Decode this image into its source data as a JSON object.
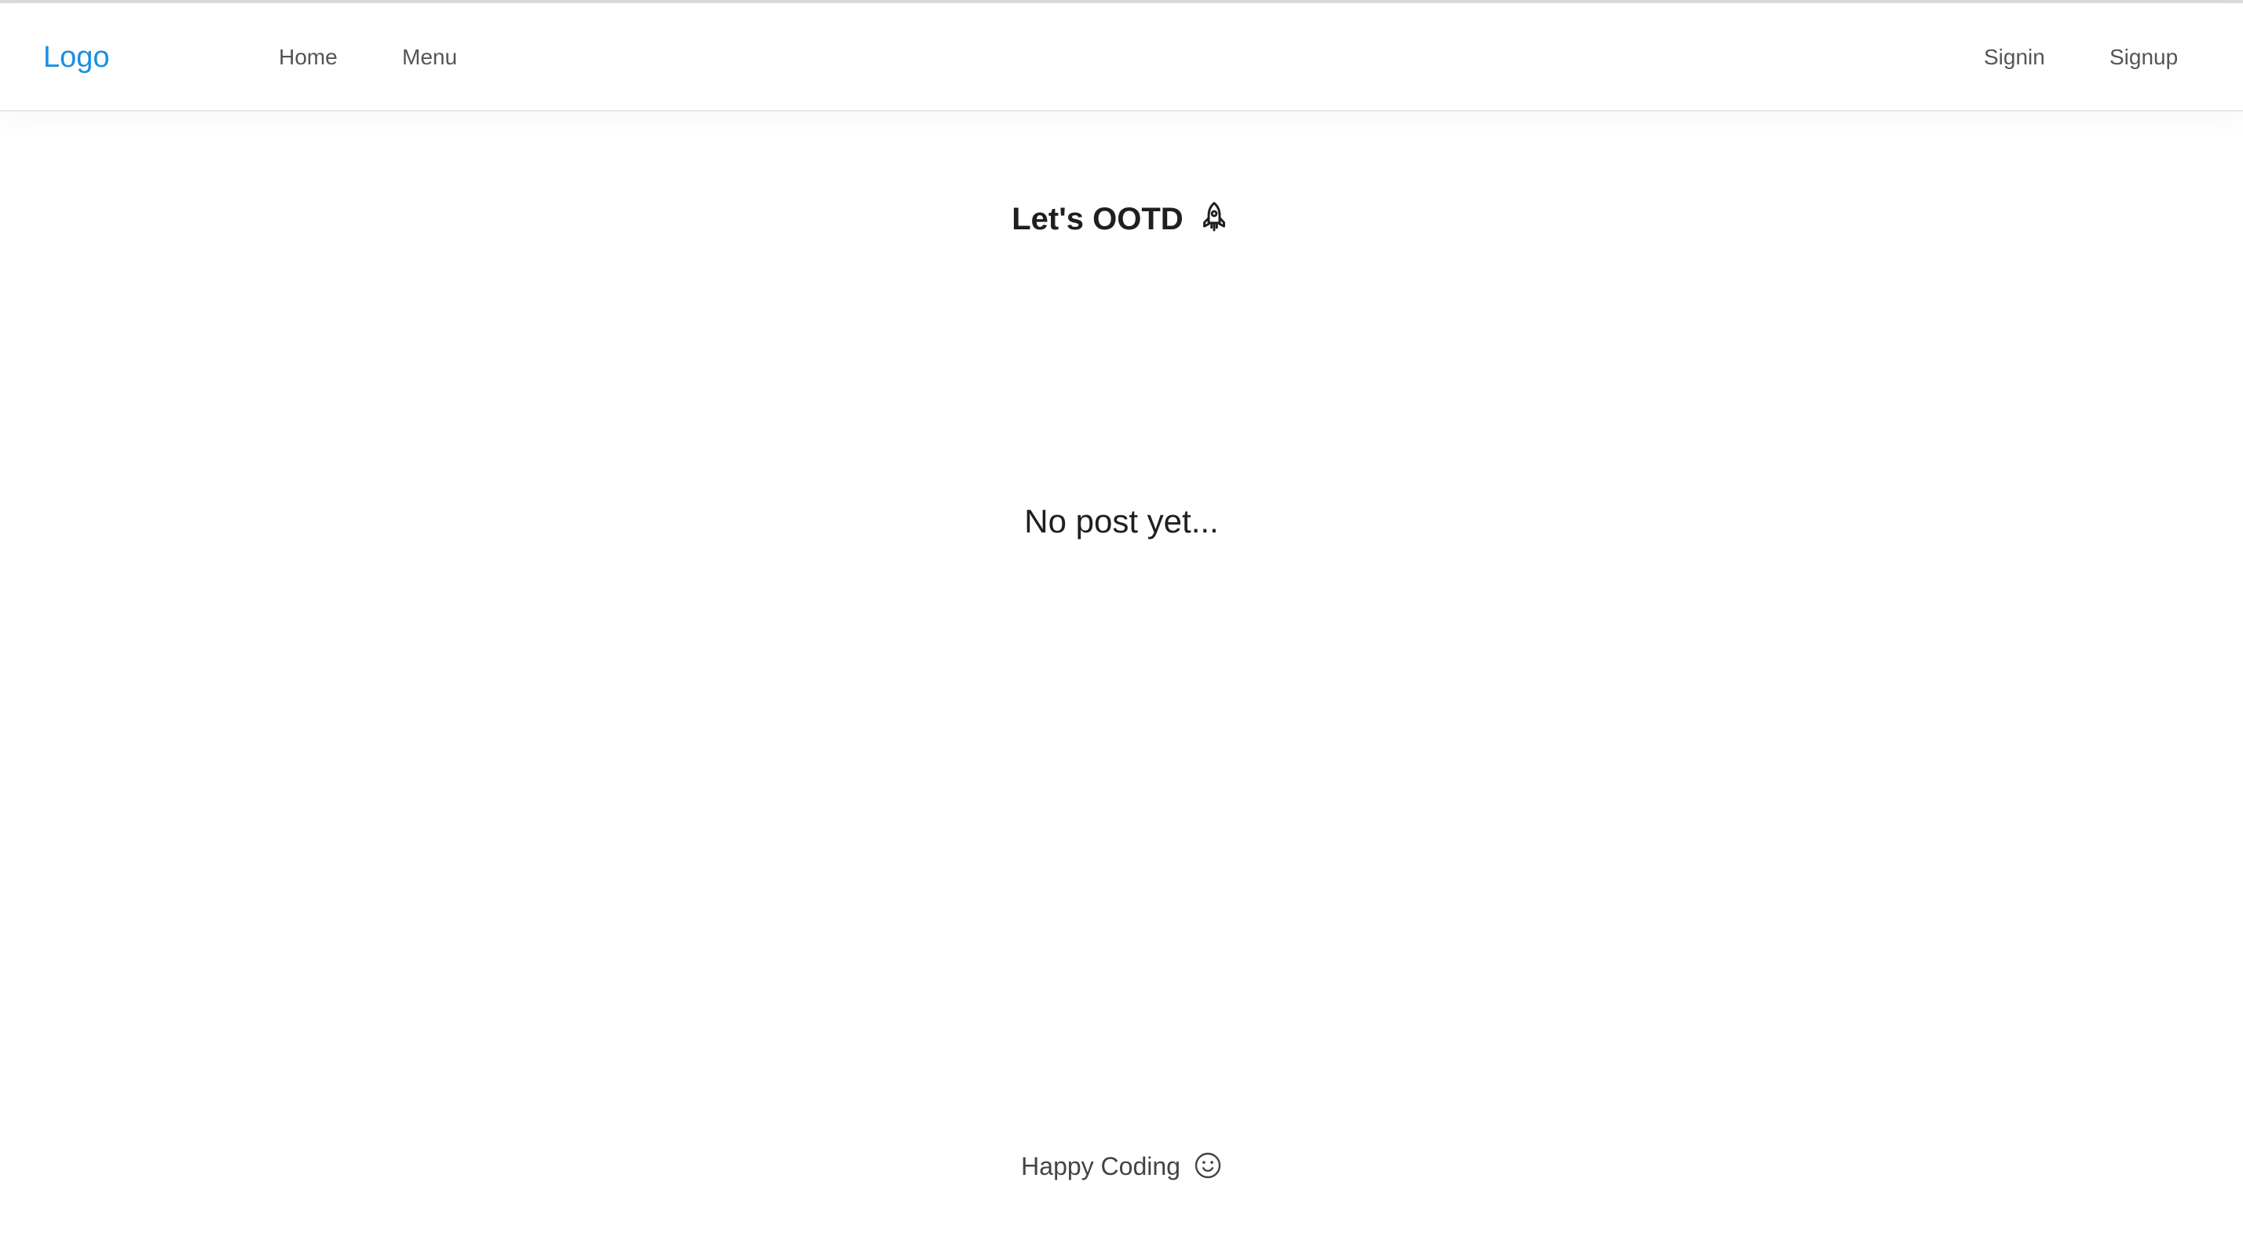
{
  "header": {
    "logo": "Logo",
    "nav_left": [
      {
        "label": "Home"
      },
      {
        "label": "Menu"
      }
    ],
    "nav_right": [
      {
        "label": "Signin"
      },
      {
        "label": "Signup"
      }
    ]
  },
  "main": {
    "title": "Let's OOTD",
    "title_icon": "rocket-icon",
    "empty_message": "No post yet..."
  },
  "footer": {
    "text": "Happy Coding",
    "icon": "smile-icon"
  },
  "colors": {
    "accent": "#1a8fe0",
    "text": "#1f1f1f",
    "nav_text": "#555555"
  }
}
